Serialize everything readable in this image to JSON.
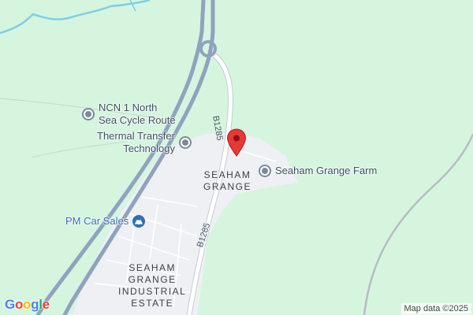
{
  "map": {
    "colors": {
      "land": "#d6f5df",
      "urban": "#eef0f4",
      "water": "#7ecfe6",
      "motorway": "#8fa3bf",
      "rail": "#b8bcc4",
      "poi_gray": "#7b8a9b",
      "poi_blue": "#2f6fb8",
      "pin": "#e53935"
    },
    "pois": [
      {
        "label": "NCN 1 North Sea Cycle Route",
        "line1": "NCN 1 North",
        "line2": "Sea Cycle Route",
        "icon": "place-pin-icon"
      },
      {
        "label": "Thermal Transfer Technology",
        "line1": "Thermal Transfer",
        "line2": "Technology",
        "icon": "place-pin-icon"
      },
      {
        "label": "Seaham Grange Farm",
        "icon": "place-pin-icon"
      },
      {
        "label": "PM Car Sales",
        "icon": "car-dealer-icon"
      }
    ],
    "areas": [
      {
        "line1": "SEAHAM",
        "line2": "GRANGE"
      },
      {
        "line1": "SEAHAM",
        "line2": "GRANGE",
        "line3": "INDUSTRIAL",
        "line4": "ESTATE"
      }
    ],
    "roads": [
      {
        "label": "B1285"
      },
      {
        "label": "B1285"
      }
    ],
    "marker": {
      "icon": "red-map-pin-icon"
    },
    "logo": {
      "letters": [
        "G",
        "o",
        "o",
        "g",
        "l",
        "e"
      ],
      "colors": [
        "#4285f4",
        "#ea4335",
        "#fbbc05",
        "#4285f4",
        "#34a853",
        "#ea4335"
      ]
    },
    "attribution": "Map data ©2025"
  }
}
